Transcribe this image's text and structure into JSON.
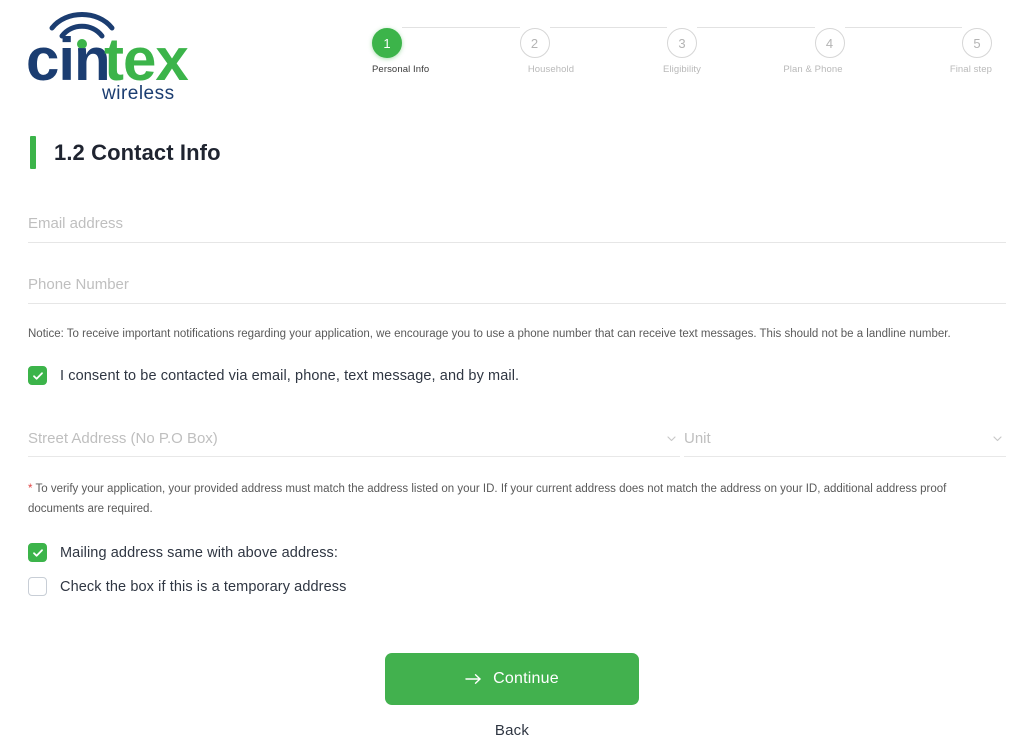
{
  "brand": {
    "logo_primary_text": "cin",
    "logo_accent_text": "tex",
    "logo_subtext": "wireless",
    "navy": "#1b3d71",
    "green": "#3cb44a"
  },
  "stepper": {
    "current_step": 1,
    "steps": [
      {
        "number": "1",
        "label": "Personal Info"
      },
      {
        "number": "2",
        "label": "Household"
      },
      {
        "number": "3",
        "label": "Eligibility"
      },
      {
        "number": "4",
        "label": "Plan & Phone"
      },
      {
        "number": "5",
        "label": "Final step"
      }
    ]
  },
  "section": {
    "title": "1.2 Contact Info",
    "accent_color": "#3cb44a"
  },
  "form": {
    "email": {
      "placeholder": "Email address",
      "value": ""
    },
    "phone": {
      "placeholder": "Phone Number",
      "value": ""
    },
    "phone_notice": "Notice: To receive important notifications regarding your application, we encourage you to use a phone number that can receive text messages. This should not be a landline number.",
    "consent_checkbox": {
      "label": "I consent to be contacted via email, phone, text message, and by mail.",
      "checked": true
    },
    "street_address": {
      "placeholder": "Street Address (No P.O Box)",
      "value": ""
    },
    "unit": {
      "placeholder": "Unit",
      "value": ""
    },
    "address_note_asterisk": "*",
    "address_note": "To verify your application, your provided address must match the address listed on your ID. If your current address does not match the address on your ID, additional address proof documents are required.",
    "mailing_checkbox": {
      "label": "Mailing address same with above address:",
      "checked": true
    },
    "temporary_checkbox": {
      "label": "Check the box if this is a temporary address",
      "checked": false
    }
  },
  "actions": {
    "continue_label": "Continue",
    "continue_color": "#42b14e",
    "back_label": "Back"
  }
}
